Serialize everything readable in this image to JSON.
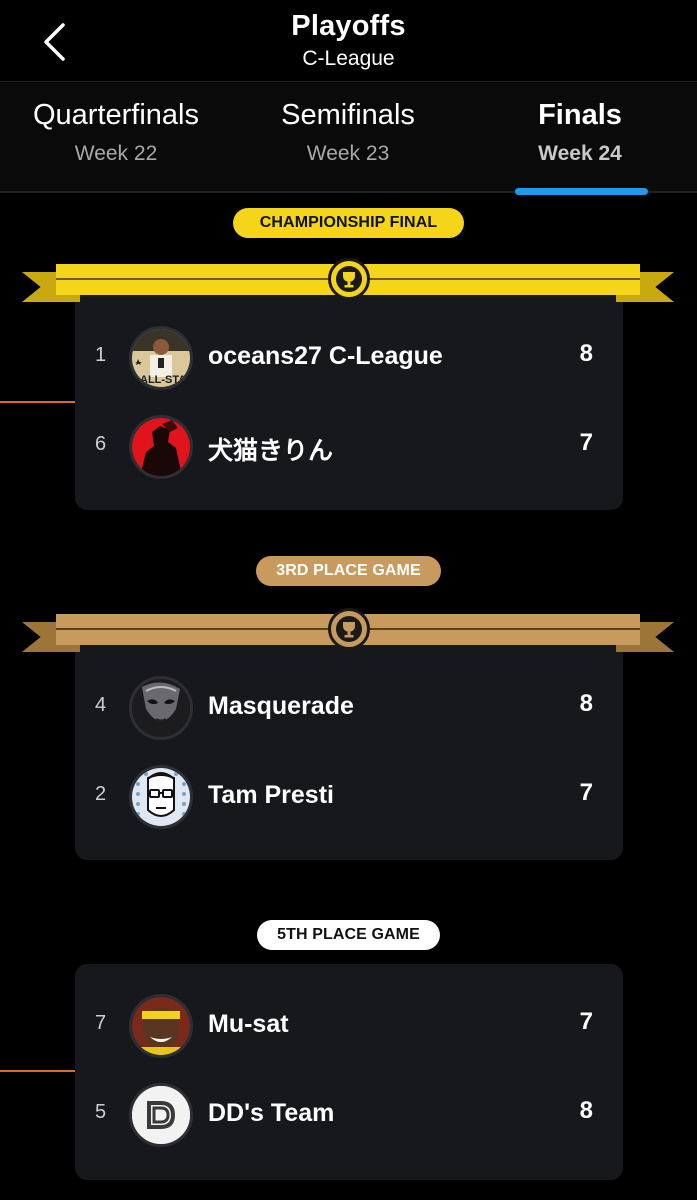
{
  "header": {
    "title": "Playoffs",
    "subtitle": "C-League"
  },
  "tabs": [
    {
      "label": "Quarterfinals",
      "week": "Week 22",
      "active": false
    },
    {
      "label": "Semifinals",
      "week": "Week 23",
      "active": false
    },
    {
      "label": "Finals",
      "week": "Week 24",
      "active": true
    }
  ],
  "colors": {
    "accent_blue": "#1e9bea",
    "championship_gold": "#f5d51a",
    "third_place_bronze": "#c99a5e",
    "fifth_place_white": "#ffffff",
    "connector_orange": "#d9692e",
    "card_bg": "#16181c"
  },
  "games": [
    {
      "label": "CHAMPIONSHIP FINAL",
      "trophy_icon": "trophy-icon",
      "teams": [
        {
          "seed": "1",
          "name": "oceans27 C-League",
          "score": "8",
          "avatar": "all-star-player-avatar"
        },
        {
          "seed": "6",
          "name": "犬猫きりん",
          "score": "7",
          "avatar": "red-silhouette-avatar"
        }
      ]
    },
    {
      "label": "3RD PLACE GAME",
      "trophy_icon": "trophy-icon",
      "teams": [
        {
          "seed": "4",
          "name": "Masquerade",
          "score": "8",
          "avatar": "mask-avatar"
        },
        {
          "seed": "2",
          "name": "Tam Presti",
          "score": "7",
          "avatar": "glasses-cartoon-avatar"
        }
      ]
    },
    {
      "label": "5TH PLACE GAME",
      "teams": [
        {
          "seed": "7",
          "name": "Mu-sat",
          "score": "7",
          "avatar": "headband-player-avatar"
        },
        {
          "seed": "5",
          "name": "DD's Team",
          "score": "8",
          "avatar": "dd-logo-avatar"
        }
      ]
    }
  ]
}
